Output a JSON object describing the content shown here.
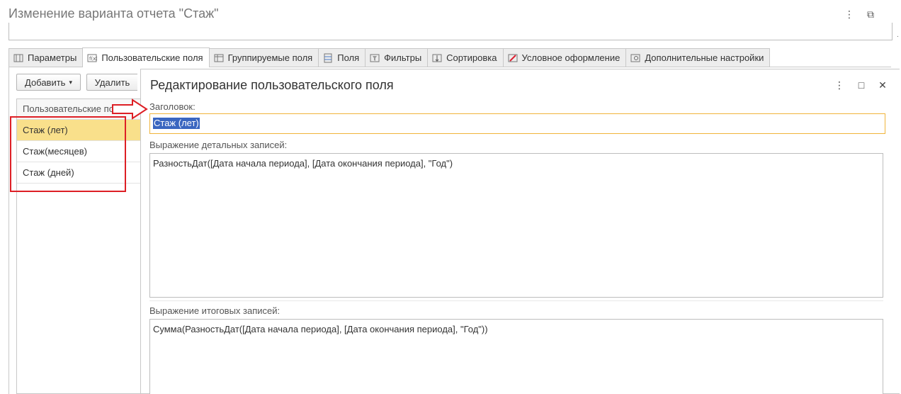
{
  "window": {
    "title": "Изменение варианта отчета \"Стаж\"",
    "more_label": "⋮",
    "restore_label": "⧉"
  },
  "tabs": [
    {
      "label": "Параметры",
      "icon": "parameters-icon"
    },
    {
      "label": "Пользовательские поля",
      "icon": "custom-fields-icon",
      "active": true
    },
    {
      "label": "Группируемые поля",
      "icon": "group-fields-icon"
    },
    {
      "label": "Поля",
      "icon": "fields-icon"
    },
    {
      "label": "Фильтры",
      "icon": "filter-icon"
    },
    {
      "label": "Сортировка",
      "icon": "sort-icon"
    },
    {
      "label": "Условное оформление",
      "icon": "conditional-format-icon"
    },
    {
      "label": "Дополнительные настройки",
      "icon": "settings-icon"
    }
  ],
  "toolbar": {
    "add_label": "Добавить",
    "add_caret": "▾",
    "delete_label": "Удалить"
  },
  "list": {
    "header": "Пользовательские поля",
    "items": [
      "Стаж (лет)",
      "Стаж(месяцев)",
      "Стаж (дней)"
    ],
    "selected_index": 0
  },
  "dialog": {
    "title": "Редактирование пользовательского поля",
    "more_label": "⋮",
    "maximize_label": "□",
    "close_label": "✕",
    "caption_label": "Заголовок:",
    "caption_value": "Стаж (лет)",
    "detail_label": "Выражение детальных записей:",
    "detail_value": "РазностьДат([Дата начала периода], [Дата окончания периода], \"Год\")",
    "total_label": "Выражение итоговых записей:",
    "total_value": "Сумма(РазностьДат([Дата начала периода], [Дата окончания периода], \"Год\"))"
  },
  "colors": {
    "selection": "#f9e08b",
    "focus_border": "#f0b43a",
    "annotation": "#dd1f25",
    "text_selection": "#3a66c0"
  }
}
